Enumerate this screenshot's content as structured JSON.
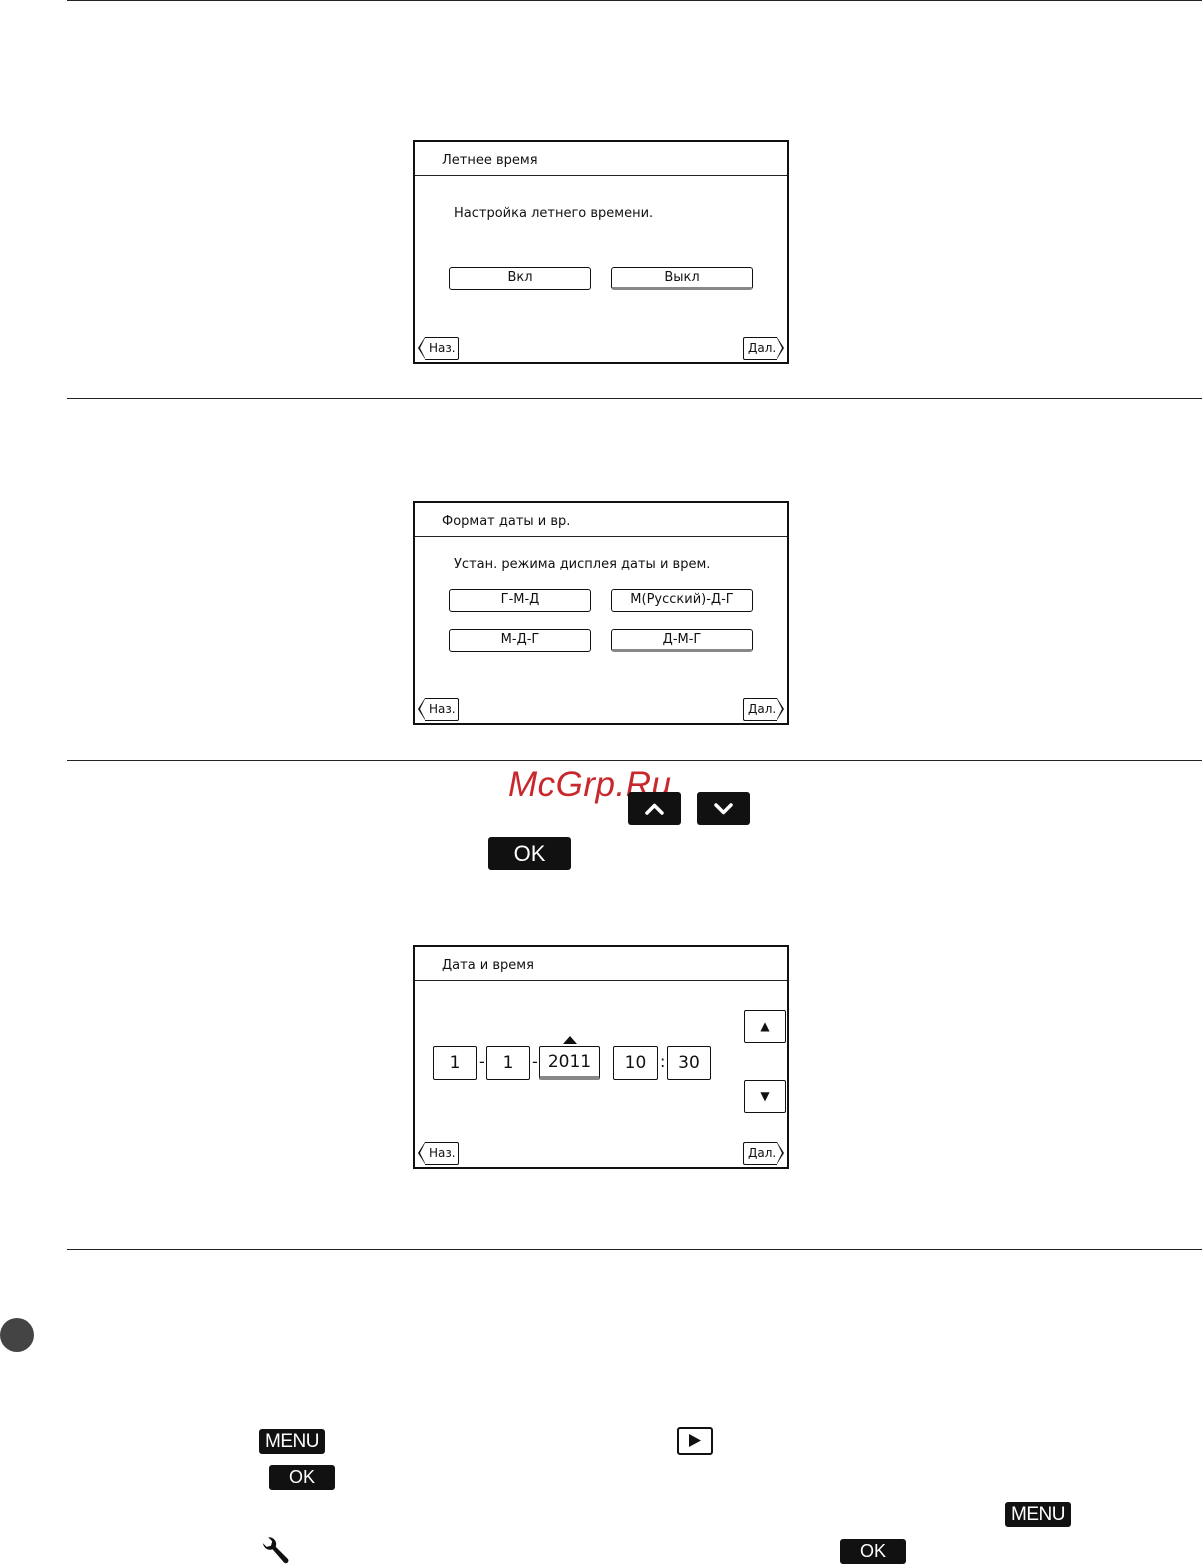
{
  "screen_dst": {
    "title": "Летнее время",
    "prompt": "Настройка летнего времени.",
    "options": [
      "Вкл",
      "Выкл"
    ],
    "selected": "Выкл",
    "back": "Наз.",
    "next": "Дал."
  },
  "screen_format": {
    "title": "Формат даты и вр.",
    "prompt": "Устан. режима дисплея даты и врем.",
    "options": [
      "Г-М-Д",
      "М(Русский)-Д-Г",
      "М-Д-Г",
      "Д-М-Г"
    ],
    "selected": "Д-М-Г",
    "back": "Наз.",
    "next": "Дал."
  },
  "screen_datetime": {
    "title": "Дата и время",
    "fields": [
      "1",
      "1",
      "2011",
      "10",
      "30"
    ],
    "separators": [
      "-",
      "-",
      ":"
    ],
    "selected_field": "2011",
    "up": "▲",
    "down": "▼",
    "back": "Наз.",
    "next": "Дал."
  },
  "watermark": "McGrp.Ru",
  "chips": {
    "ok": "OK",
    "menu": "MENU"
  },
  "icons": {
    "up": "chevron-up-icon",
    "down": "chevron-down-icon",
    "play": "play-icon",
    "wrench": "wrench-icon"
  }
}
